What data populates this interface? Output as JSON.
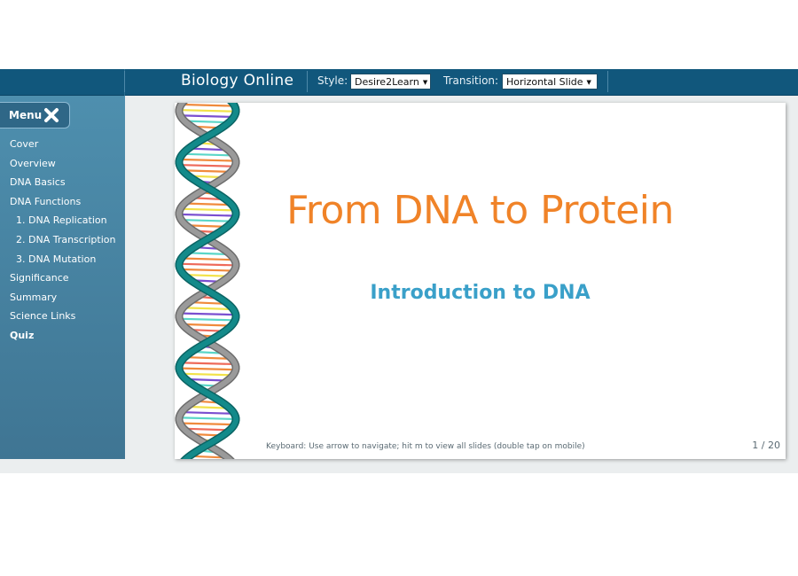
{
  "header": {
    "title": "Biology Online",
    "style_label": "Style:",
    "style_value": "Desire2Learn",
    "transition_label": "Transition:",
    "transition_value": "Horizontal Slide"
  },
  "sidebar": {
    "menu_label": "Menu",
    "items": [
      {
        "label": "Cover"
      },
      {
        "label": "Overview"
      },
      {
        "label": "DNA Basics"
      },
      {
        "label": "DNA Functions"
      },
      {
        "label": "1. DNA Replication"
      },
      {
        "label": "2. DNA Transcription"
      },
      {
        "label": "3. DNA Mutation"
      },
      {
        "label": "Significance"
      },
      {
        "label": "Summary"
      },
      {
        "label": "Science Links"
      },
      {
        "label": "Quiz"
      }
    ]
  },
  "slide": {
    "title": "From DNA to Protein",
    "subtitle": "Introduction to DNA",
    "keyboard_hint": "Keyboard: Use arrow to navigate; hit m to view all slides (double tap on mobile)",
    "page_indicator": "1 / 20"
  },
  "colors": {
    "header_bg": "#11577c",
    "sidebar_bg": "#4786a5",
    "title_orange": "#f08328",
    "subtitle_blue": "#3aa0c9",
    "helix_teal": "#138a8a",
    "helix_gray": "#9a9a9a"
  },
  "icons": {
    "menu_close": "close-icon",
    "dropdown": "chevron-down-icon"
  }
}
